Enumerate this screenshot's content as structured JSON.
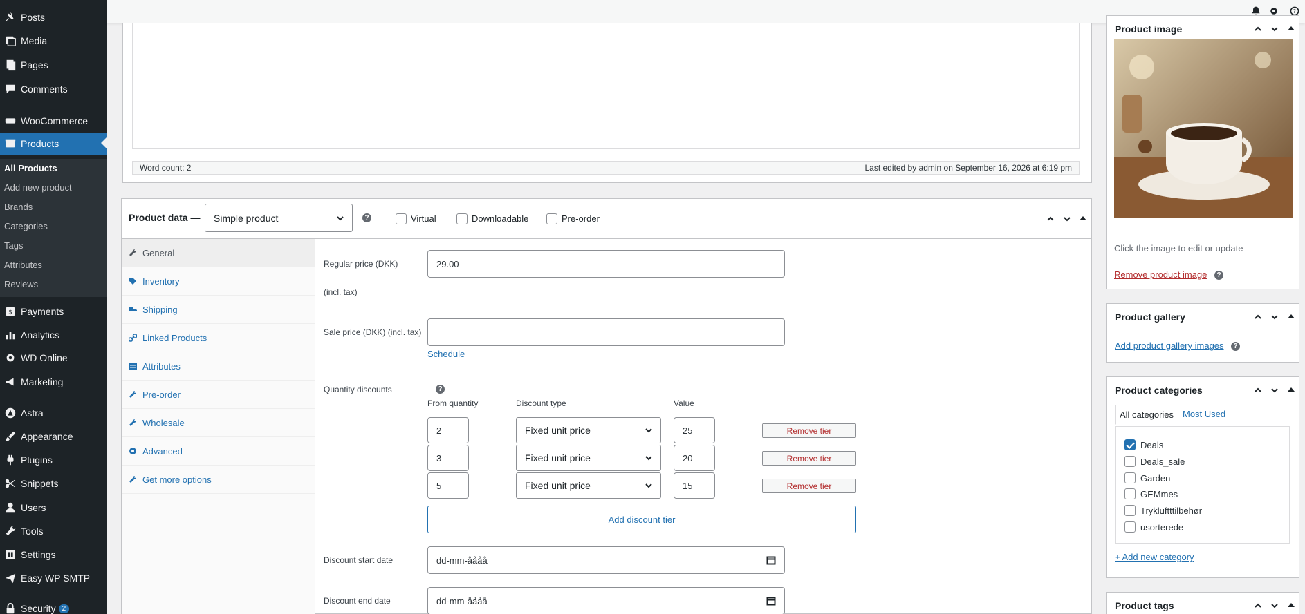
{
  "admin_menu": {
    "items": [
      {
        "label": "Posts",
        "icon": "pin-icon"
      },
      {
        "label": "Media",
        "icon": "media-icon"
      },
      {
        "label": "Pages",
        "icon": "pages-icon"
      },
      {
        "label": "Comments",
        "icon": "comments-icon"
      },
      {
        "label": "WooCommerce",
        "icon": "woocommerce-icon"
      },
      {
        "label": "Products",
        "icon": "products-icon"
      },
      {
        "label": "Payments",
        "icon": "payments-icon"
      },
      {
        "label": "Analytics",
        "icon": "analytics-icon"
      },
      {
        "label": "WD Online",
        "icon": "gear-icon"
      },
      {
        "label": "Marketing",
        "icon": "megaphone-icon"
      },
      {
        "label": "Astra",
        "icon": "astra-icon"
      },
      {
        "label": "Appearance",
        "icon": "brush-icon"
      },
      {
        "label": "Plugins",
        "icon": "plug-icon"
      },
      {
        "label": "Snippets",
        "icon": "scissors-icon"
      },
      {
        "label": "Users",
        "icon": "users-icon"
      },
      {
        "label": "Tools",
        "icon": "wrench-icon"
      },
      {
        "label": "Settings",
        "icon": "settings-icon"
      },
      {
        "label": "Easy WP SMTP",
        "icon": "smtp-icon"
      },
      {
        "label": "Security",
        "icon": "lock-icon",
        "badge": "2"
      }
    ],
    "submenu": [
      "All Products",
      "Add new product",
      "Brands",
      "Categories",
      "Tags",
      "Attributes",
      "Reviews"
    ]
  },
  "editor": {
    "word_count": "Word count: 2",
    "last_edited": "Last edited by admin on September 16, 2026 at 6:19 pm"
  },
  "product_data": {
    "title": "Product data —",
    "type_value": "Simple product",
    "virtual_label": "Virtual",
    "downloadable_label": "Downloadable",
    "preorder_label": "Pre-order",
    "tabs": [
      "General",
      "Inventory",
      "Shipping",
      "Linked Products",
      "Attributes",
      "Pre-order",
      "Wholesale",
      "Advanced",
      "Get more options"
    ],
    "regular_price_label": "Regular price (DKK)",
    "regular_price_sub": "(incl. tax)",
    "regular_price_value": "29.00",
    "sale_price_label": "Sale price (DKK) (incl. tax)",
    "sale_price_value": "",
    "schedule_link": "Schedule",
    "qty_discounts_label": "Quantity discounts",
    "col_from": "From quantity",
    "col_type": "Discount type",
    "col_value": "Value",
    "tiers": [
      {
        "qty": "2",
        "type": "Fixed unit price",
        "value": "25",
        "remove": "Remove tier"
      },
      {
        "qty": "3",
        "type": "Fixed unit price",
        "value": "20",
        "remove": "Remove tier"
      },
      {
        "qty": "5",
        "type": "Fixed unit price",
        "value": "15",
        "remove": "Remove tier"
      }
    ],
    "add_tier": "Add discount tier",
    "start_date_label": "Discount start date",
    "start_date_value": "dd-mm-åååå",
    "end_date_label": "Discount end date",
    "end_date_value": "dd-mm-åååå"
  },
  "sidebar": {
    "product_image": {
      "title": "Product image",
      "hint": "Click the image to edit or update",
      "remove_link": "Remove product image"
    },
    "product_gallery": {
      "title": "Product gallery",
      "add_link": "Add product gallery images"
    },
    "product_categories": {
      "title": "Product categories",
      "tab_all": "All categories",
      "tab_most_used": "Most Used",
      "items": [
        {
          "label": "Deals",
          "checked": true
        },
        {
          "label": "Deals_sale",
          "checked": false
        },
        {
          "label": "Garden",
          "checked": false
        },
        {
          "label": "GEMmes",
          "checked": false
        },
        {
          "label": "Trykluftttilbehør",
          "checked": false
        },
        {
          "label": "usorterede",
          "checked": false
        }
      ],
      "add_link": "+ Add new category"
    },
    "product_tags": {
      "title": "Product tags"
    }
  },
  "colors": {
    "admin_bg": "#1d2327",
    "accent": "#2271b1",
    "danger": "#b32d2e"
  }
}
